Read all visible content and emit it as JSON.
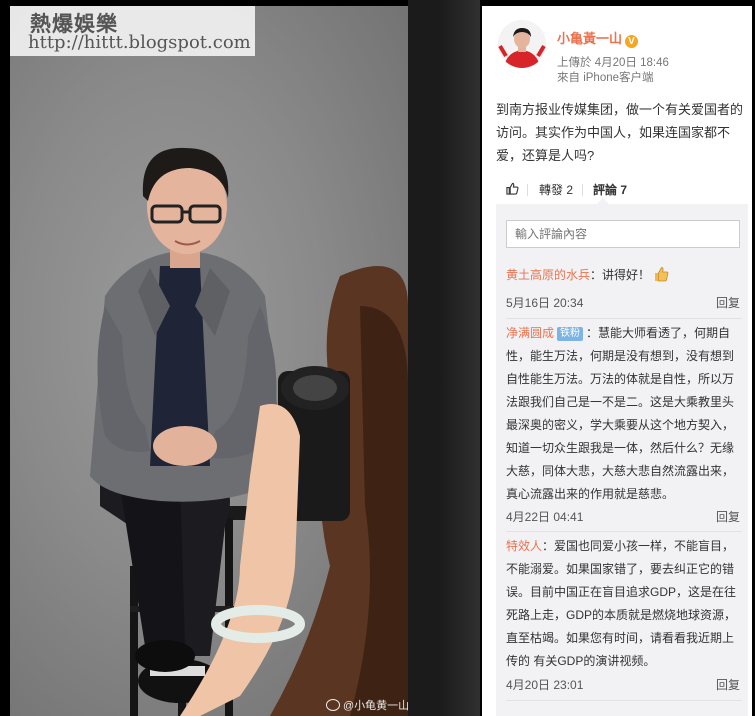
{
  "watermark": {
    "title": "熱爆娛樂",
    "url": "http://hittt.blogspot.com"
  },
  "photo": {
    "credit": "@小龟黄一山"
  },
  "post": {
    "username": "小亀黃一山",
    "verified_icon": "verified-badge-icon",
    "posted_time": "上傳於 4月20日 18:46",
    "source": "來自 iPhone客户端",
    "text": "到南方报业传媒集团，做一个有关爱国者的访问。其实作为中国人，如果连国家都不爱，还算是人吗?",
    "actions": {
      "like_icon": "thumb-up-icon",
      "repost_label": "轉發 2",
      "comment_label": "評論 7"
    }
  },
  "comments_section": {
    "input_placeholder": "輸入評論內容",
    "reply_label": "回复",
    "items": [
      {
        "author": "黄土高原的水兵",
        "text": "：讲得好！",
        "time": "5月16日 20:34"
      },
      {
        "author": "净满圆成",
        "badge": "铁粉",
        "text": "：慧能大师看透了，何期自性，能生万法，何期是没有想到，没有想到自性能生万法。万法的体就是自性，所以万法跟我们自己是一不是二。这是大乘教里头最深奥的密义，学大乘要从这个地方契入，知道一切众生跟我是一体，然后什么？无缘大慈，同体大悲，大慈大悲自然流露出来，真心流露出来的作用就是慈悲。",
        "time": "4月22日 04:41"
      },
      {
        "author": "特效人",
        "text": "：爱国也同爱小孩一样，不能盲目，不能溺爱。如果国家错了，要去纠正它的错误。目前中国正在盲目追求GDP，这是在往死路上走，GDP的本质就是燃烧地球资源，直至枯竭。如果您有时间，请看看我近期上传的 有关GDP的演讲视频。",
        "time": "4月20日 23:01"
      }
    ]
  },
  "colors": {
    "accent": "#eb7350",
    "comment_bg": "#f2f2f5",
    "badge": "#7cb4e6"
  }
}
